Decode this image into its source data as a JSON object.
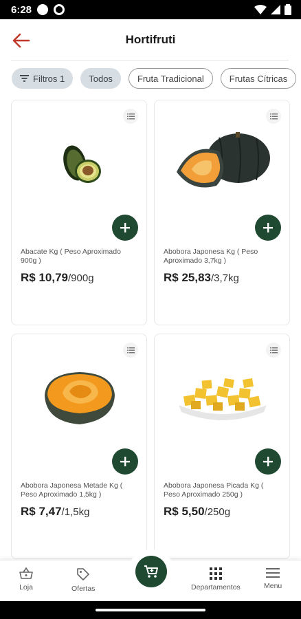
{
  "status_bar": {
    "time": "6:28"
  },
  "header": {
    "title": "Hortifruti"
  },
  "chips": [
    {
      "label": "Filtros 1",
      "style": "filled"
    },
    {
      "label": "Todos",
      "style": "filled"
    },
    {
      "label": "Fruta Tradicional",
      "style": "outline"
    },
    {
      "label": "Frutas Cítricas",
      "style": "outline"
    }
  ],
  "products": [
    {
      "name": "Abacate Kg ( Peso Aproximado 900g )",
      "price": "R$ 10,79",
      "unit": "/900g",
      "image": "avocado"
    },
    {
      "name": "Abobora Japonesa Kg ( Peso Aproximado 3,7kg )",
      "price": "R$ 25,83",
      "unit": "/3,7kg",
      "image": "pumpkin-whole"
    },
    {
      "name": "Abobora Japonesa Metade Kg ( Peso Aproximado 1,5kg )",
      "price": "R$ 7,47",
      "unit": "/1,5kg",
      "image": "pumpkin-half"
    },
    {
      "name": "Abobora Japonesa Picada Kg ( Peso Aproximado 250g )",
      "price": "R$ 5,50",
      "unit": "/250g",
      "image": "pumpkin-diced"
    }
  ],
  "bottom_nav": {
    "loja": "Loja",
    "ofertas": "Ofertas",
    "departamentos": "Departamentos",
    "menu": "Menu"
  },
  "colors": {
    "brand_green": "#1f4a31",
    "back_arrow": "#c0392b",
    "chip_filled": "#d6dde3"
  }
}
